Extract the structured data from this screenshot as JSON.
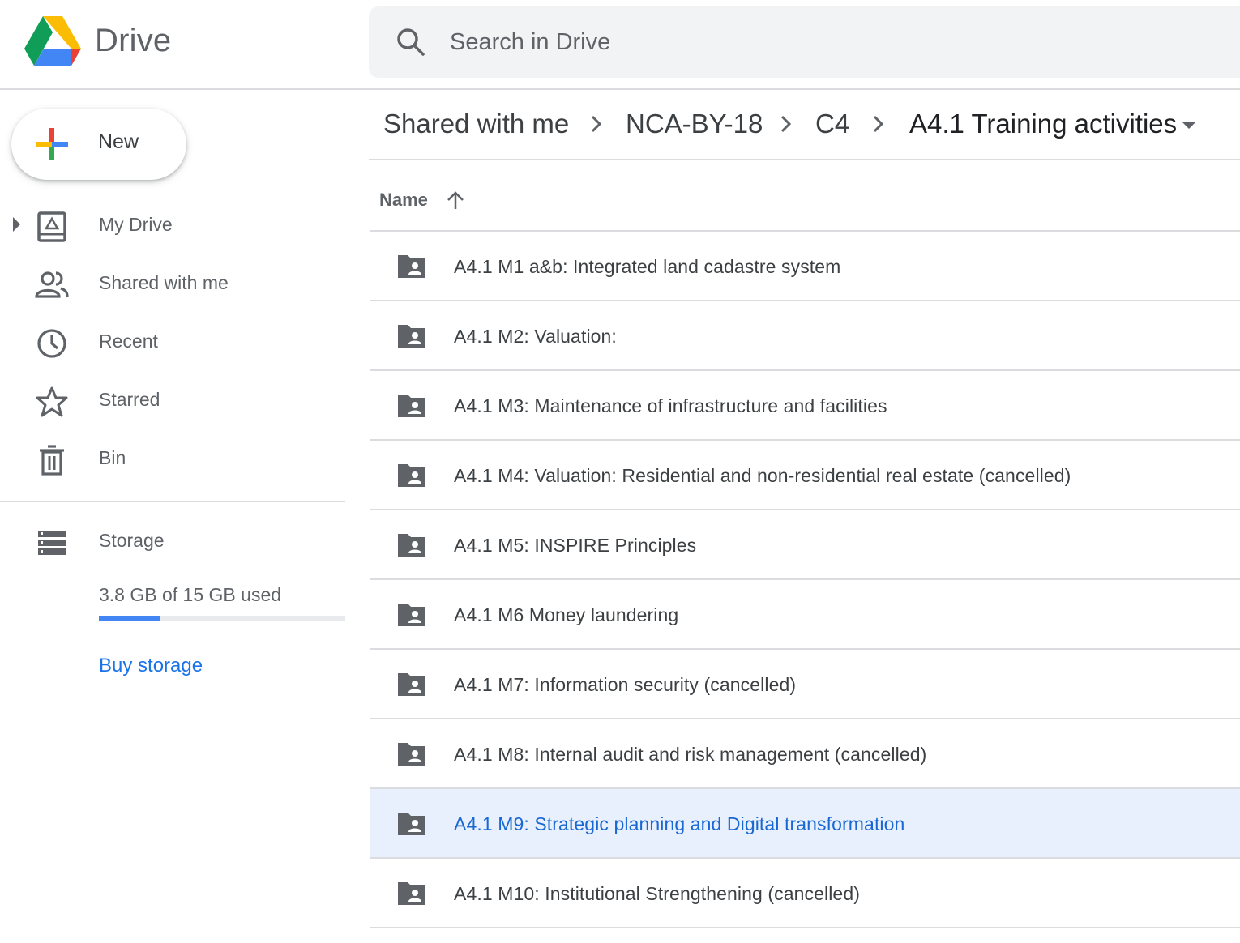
{
  "app": {
    "title": "Drive"
  },
  "search": {
    "placeholder": "Search in Drive"
  },
  "new_button": {
    "label": "New"
  },
  "nav": [
    {
      "label": "My Drive",
      "icon": "my-drive-icon"
    },
    {
      "label": "Shared with me",
      "icon": "people-icon"
    },
    {
      "label": "Recent",
      "icon": "clock-icon"
    },
    {
      "label": "Starred",
      "icon": "star-icon"
    },
    {
      "label": "Bin",
      "icon": "trash-icon"
    },
    {
      "label": "Storage",
      "icon": "storage-icon"
    }
  ],
  "storage": {
    "used_text": "3.8 GB of 15 GB used",
    "used_fraction": 0.25,
    "buy_label": "Buy storage"
  },
  "breadcrumb": {
    "items": [
      "Shared with me",
      "NCA-BY-18",
      "C4"
    ],
    "current": "A4.1 Training activities"
  },
  "list": {
    "column_name": "Name",
    "rows": [
      {
        "name": "A4.1 M1 a&b: Integrated land cadastre system"
      },
      {
        "name": "A4.1 M2: Valuation:"
      },
      {
        "name": "A4.1 M3: Maintenance of infrastructure and facilities"
      },
      {
        "name": "A4.1 M4: Valuation: Residential and non-residential real estate (cancelled)"
      },
      {
        "name": "A4.1 M5: INSPIRE Principles"
      },
      {
        "name": "A4.1 M6 Money laundering"
      },
      {
        "name": "A4.1 M7: Information security (cancelled)"
      },
      {
        "name": "A4.1 M8: Internal audit and risk management (cancelled)"
      },
      {
        "name": "A4.1 M9: Strategic planning and Digital transformation",
        "selected": true
      },
      {
        "name": "A4.1 M10: Institutional Strengthening (cancelled)"
      }
    ]
  },
  "colors": {
    "accent": "#1a73e8",
    "selected_row": "#e8f0fe",
    "selected_text": "#1967d2"
  }
}
